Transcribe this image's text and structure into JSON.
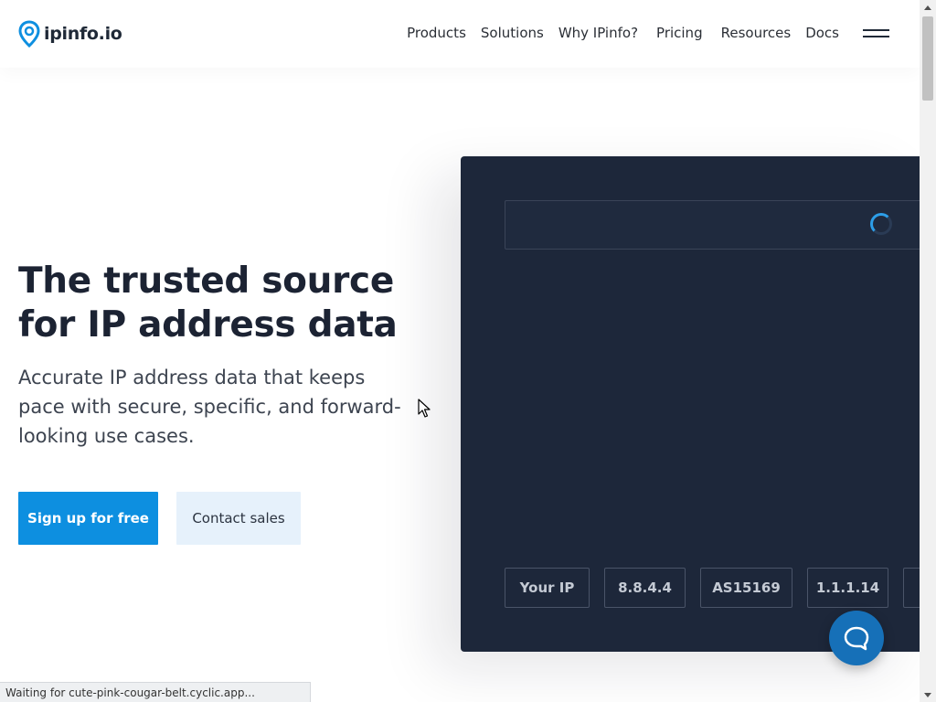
{
  "header": {
    "logo_text": "ipinfo.io",
    "nav": [
      "Products",
      "Solutions",
      "Why IPinfo?",
      "Pricing",
      "Resources",
      "Docs"
    ]
  },
  "hero": {
    "title": "The trusted source for IP address data",
    "subtitle": "Accurate IP address data that keeps pace with secure, specific, and forward-looking use cases.",
    "primary_cta": "Sign up for free",
    "secondary_cta": "Contact sales"
  },
  "demo": {
    "input_value": "",
    "chips": [
      "Your IP",
      "8.8.4.4",
      "AS15169",
      "1.1.1.14",
      ""
    ]
  },
  "status": {
    "text": "Waiting for cute-pink-cougar-belt.cyclic.app..."
  },
  "icons": {
    "logo": "location-pin-icon",
    "menu": "hamburger-menu-icon",
    "loading": "spinner-icon",
    "chat": "chat-bubble-icon"
  },
  "colors": {
    "brand_blue": "#0d8fe0",
    "secondary_bg": "#e6f1fb",
    "panel_bg": "#1d273a",
    "chat_blue": "#1670b8"
  }
}
